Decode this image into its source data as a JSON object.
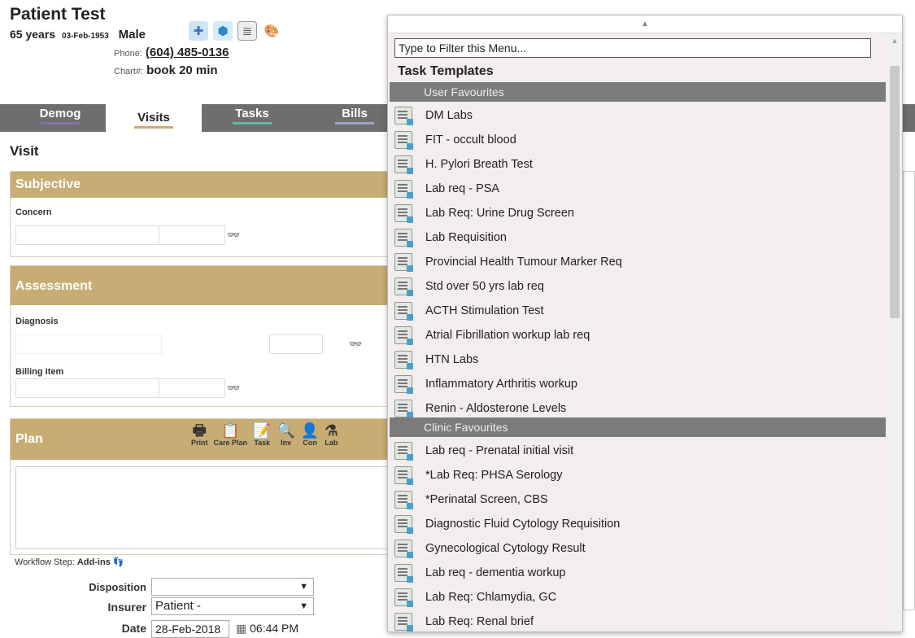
{
  "patient": {
    "name": "Patient Test",
    "age": "65 years",
    "dob": "03-Feb-1953",
    "sex": "Male",
    "phone_label": "Phone:",
    "phone": "(604) 485-0136",
    "chart_label": "Chart#:",
    "chart": "book 20 min"
  },
  "header_icons": [
    "medical-kit-icon",
    "cube-icon",
    "notes-icon",
    "palette-icon"
  ],
  "tabs": [
    {
      "label": "Demog",
      "accent": "#8a6fb0"
    },
    {
      "label": "Visits",
      "accent": "#c7ad74",
      "active": true
    },
    {
      "label": "Tasks",
      "accent": "#5fb8a8"
    },
    {
      "label": "Bills",
      "accent": "#9aa6c8"
    }
  ],
  "visit": {
    "title": "Visit",
    "subjective": {
      "title": "Subjective",
      "concern_label": "Concern"
    },
    "assessment": {
      "title": "Assessment",
      "diagnosis_label": "Diagnosis",
      "billing_label": "Billing Item"
    },
    "plan": {
      "title": "Plan",
      "tools": [
        {
          "label": "Print",
          "icon": "printer-icon",
          "glyph": "🖶"
        },
        {
          "label": "Care Plan",
          "icon": "clipboard-icon",
          "glyph": "📋"
        },
        {
          "label": "Task",
          "icon": "task-icon",
          "glyph": "📝"
        },
        {
          "label": "Inv",
          "icon": "magnifier-icon",
          "glyph": "🔍"
        },
        {
          "label": "Con",
          "icon": "consult-icon",
          "glyph": "👤"
        },
        {
          "label": "Lab",
          "icon": "flask-icon",
          "glyph": "⚗"
        }
      ]
    },
    "workflow_label": "Workflow Step:",
    "workflow_value": "Add-ins",
    "disposition_label": "Disposition",
    "disposition_value": "",
    "insurer_label": "Insurer",
    "insurer_value": "Patient -",
    "date_label": "Date",
    "date_value": "28-Feb-2018",
    "time_value": "06:44 PM"
  },
  "menu": {
    "filter_value": "Type to Filter this Menu...",
    "header": "Task Templates",
    "user_favourites_label": "User Favourites",
    "user_favourites": [
      "DM Labs",
      "FIT - occult blood",
      "H. Pylori Breath Test",
      "Lab req - PSA",
      "Lab Req: Urine Drug Screen",
      "Lab Requisition",
      "Provincial Health Tumour Marker Req",
      "Std over 50 yrs lab req",
      "ACTH Stimulation Test",
      "Atrial Fibrillation workup lab req",
      "HTN Labs",
      "Inflammatory Arthritis workup",
      "Renin - Aldosterone Levels"
    ],
    "clinic_favourites_label": "Clinic Favourites",
    "clinic_favourites": [
      "Lab req - Prenatal initial visit",
      "*Lab Req: PHSA Serology",
      "*Perinatal Screen, CBS",
      "Diagnostic Fluid Cytology Requisition",
      "Gynecological Cytology Result",
      "Lab req - dementia workup",
      "Lab Req: Chlamydia, GC",
      "Lab Req: Renal brief"
    ],
    "submenu_item_index": 5
  }
}
